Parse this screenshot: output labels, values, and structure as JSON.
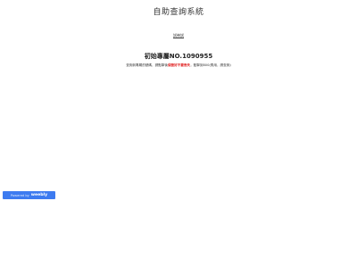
{
  "site": {
    "title": "自助查詢系統"
  },
  "nav": {
    "link_label": "試神試"
  },
  "main": {
    "heading": "初始專屬NO.1090955",
    "notice_before": "查詢到專屬的號碼，請點擊後",
    "notice_warning": "保管好不要丟失",
    "notice_after": "，點擊到800(費用，請查詢)"
  },
  "footer": {
    "badge_prefix": "Powered by",
    "badge_brand": "weebly"
  },
  "colors": {
    "badge_bg": "#3d7bf0",
    "warning_text": "#e02020"
  }
}
